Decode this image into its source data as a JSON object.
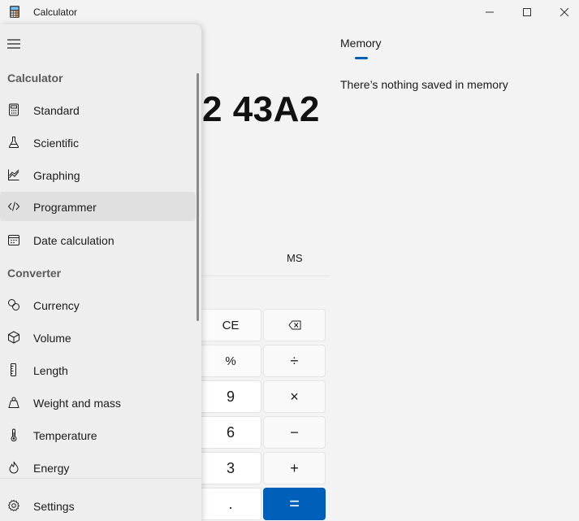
{
  "window": {
    "title": "Calculator"
  },
  "display": {
    "value": "2 43A2"
  },
  "memory_row": {
    "ms_label": "MS"
  },
  "keypad": {
    "ce": "CE",
    "backspace_icon": "backspace-icon",
    "percent": "%",
    "divide": "÷",
    "nine": "9",
    "multiply": "×",
    "six": "6",
    "minus": "−",
    "three": "3",
    "plus": "+",
    "decimal": ".",
    "equals": "="
  },
  "memory_pane": {
    "tab_label": "Memory",
    "empty_text": "There’s nothing saved in memory"
  },
  "nav": {
    "calculator_header": "Calculator",
    "converter_header": "Converter",
    "calculator_items": [
      {
        "label": "Standard",
        "icon": "calculator-icon"
      },
      {
        "label": "Scientific",
        "icon": "flask-icon"
      },
      {
        "label": "Graphing",
        "icon": "graph-icon"
      },
      {
        "label": "Programmer",
        "icon": "code-icon",
        "selected": true
      },
      {
        "label": "Date calculation",
        "icon": "calendar-icon"
      }
    ],
    "converter_items": [
      {
        "label": "Currency",
        "icon": "currency-icon"
      },
      {
        "label": "Volume",
        "icon": "cube-icon"
      },
      {
        "label": "Length",
        "icon": "ruler-icon"
      },
      {
        "label": "Weight and mass",
        "icon": "weight-icon"
      },
      {
        "label": "Temperature",
        "icon": "thermometer-icon"
      },
      {
        "label": "Energy",
        "icon": "flame-icon"
      }
    ],
    "settings_label": "Settings"
  },
  "colors": {
    "accent": "#005fb8",
    "nav_bg": "#eeeeee",
    "app_bg": "#f3f3f3",
    "selected_bg": "#e0e0e0"
  }
}
